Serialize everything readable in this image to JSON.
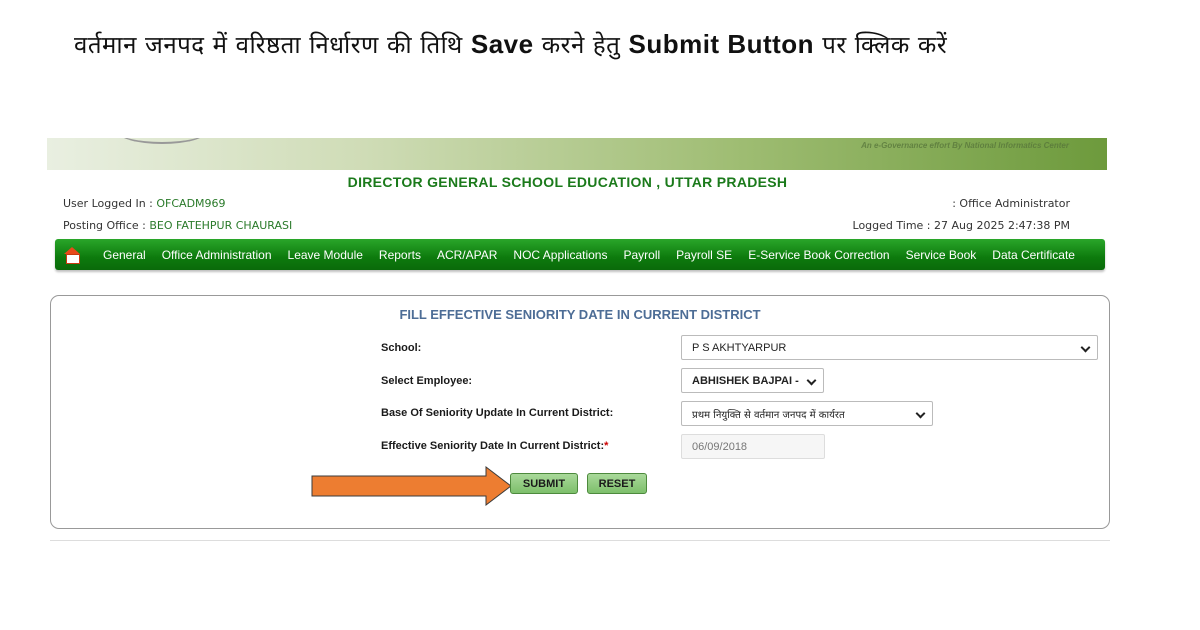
{
  "instruction": {
    "part1": "वर्तमान जनपद में वरिष्ठता निर्धारण की तिथि ",
    "bold1": "Save",
    "part2": " करने हेतु ",
    "bold2": "Submit Button",
    "part3": " पर क्लिक करें"
  },
  "banner": {
    "tagline": "An e-Governance effort By National Informatics Center"
  },
  "header": {
    "title": "DIRECTOR GENERAL SCHOOL EDUCATION , UTTAR PRADESH",
    "user_label": "User Logged In : ",
    "user_value": "OFCADM969",
    "office_label": "Posting Office : ",
    "office_value": "BEO FATEHPUR CHAURASI",
    "role": ": Office Administrator",
    "logged_time": "Logged Time : 27 Aug 2025 2:47:38 PM"
  },
  "menu": {
    "home_icon": "home-icon",
    "items": [
      "General",
      "Office Administration",
      "Leave Module",
      "Reports",
      "ACR/APAR",
      "NOC Applications",
      "Payroll",
      "Payroll SE",
      "E-Service Book Correction",
      "Service Book",
      "Data Certificate"
    ]
  },
  "form": {
    "title": "FILL EFFECTIVE SENIORITY DATE IN CURRENT DISTRICT",
    "school_label": "School:",
    "school_value": "P S AKHTYARPUR",
    "employee_label": "Select Employee:",
    "employee_value": "ABHISHEK BAJPAI -",
    "base_label": "Base Of Seniority Update In Current District:",
    "base_value": "प्रथम नियुक्ति से वर्तमान जनपद में कार्यरत",
    "date_label": "Effective Seniority Date In Current District:",
    "date_required": "*",
    "date_value": "06/09/2018",
    "submit_label": "SUBMIT",
    "reset_label": "RESET"
  },
  "colors": {
    "arrow": "#ed7d31",
    "menu_green": "#0d7a0d",
    "title_green": "#1b7a1b"
  }
}
